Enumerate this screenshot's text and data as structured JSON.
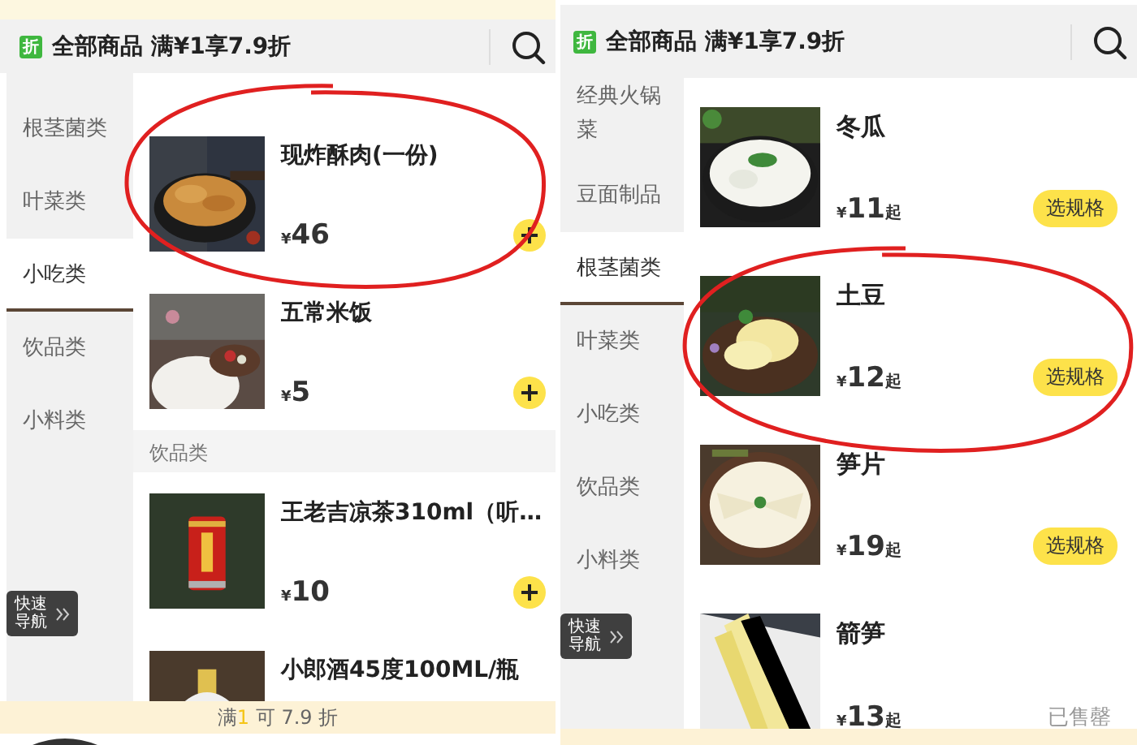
{
  "panels": [
    {
      "header": {
        "badge": "折",
        "title": "全部商品 满¥1享7.9折"
      },
      "sidebar": [
        {
          "label": "根茎菌类",
          "selected": false
        },
        {
          "label": "叶菜类",
          "selected": false
        },
        {
          "label": "小吃类",
          "selected": true
        },
        {
          "label": "饮品类",
          "selected": false
        },
        {
          "label": "小料类",
          "selected": false
        }
      ],
      "quick_nav": "快速导航",
      "list": [
        {
          "kind": "product",
          "name": "现炸酥肉(一份)",
          "currency": "¥",
          "price": "46",
          "action": {
            "kind": "add"
          },
          "circled": true
        },
        {
          "kind": "product",
          "name": "五常米饭",
          "currency": "¥",
          "price": "5",
          "action": {
            "kind": "add"
          },
          "circled": false
        },
        {
          "kind": "section",
          "title": "饮品类"
        },
        {
          "kind": "product",
          "name": "王老吉凉茶310ml（听…",
          "currency": "¥",
          "price": "10",
          "action": {
            "kind": "add"
          },
          "circled": false
        },
        {
          "kind": "product",
          "name": "小郎酒45度100ML/瓶",
          "circled": false
        }
      ],
      "footer": {
        "prefix": "满",
        "amount": "1",
        "suffix": "可 7.9 折"
      }
    },
    {
      "header": {
        "badge": "折",
        "title": "全部商品 满¥1享7.9折"
      },
      "sidebar": [
        {
          "label": "经典火锅菜",
          "selected": false
        },
        {
          "label": "豆面制品",
          "selected": false
        },
        {
          "label": "根茎菌类",
          "selected": true
        },
        {
          "label": "叶菜类",
          "selected": false
        },
        {
          "label": "小吃类",
          "selected": false
        },
        {
          "label": "饮品类",
          "selected": false
        },
        {
          "label": "小料类",
          "selected": false
        }
      ],
      "quick_nav": "快速导航",
      "list": [
        {
          "kind": "product",
          "name": "冬瓜",
          "currency": "¥",
          "price": "11",
          "unit": "起",
          "action": {
            "kind": "spec",
            "label": "选规格"
          },
          "circled": false
        },
        {
          "kind": "product",
          "name": "土豆",
          "currency": "¥",
          "price": "12",
          "unit": "起",
          "action": {
            "kind": "spec",
            "label": "选规格"
          },
          "circled": true
        },
        {
          "kind": "product",
          "name": "笋片",
          "currency": "¥",
          "price": "19",
          "unit": "起",
          "action": {
            "kind": "spec",
            "label": "选规格"
          },
          "circled": false
        },
        {
          "kind": "product",
          "name": "箭笋",
          "currency": "¥",
          "price": "13",
          "unit": "起",
          "action": {
            "kind": "sold_out",
            "label": "已售罄"
          },
          "circled": false
        }
      ]
    }
  ]
}
